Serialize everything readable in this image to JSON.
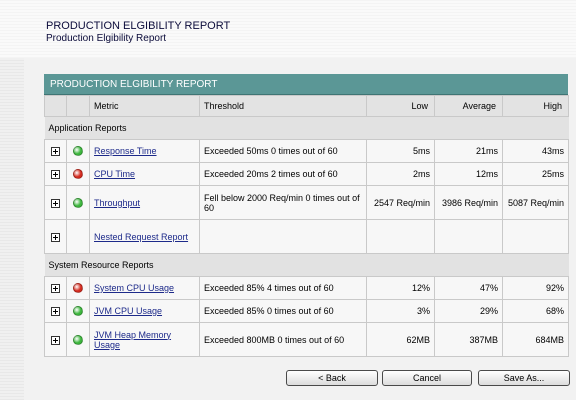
{
  "header": {
    "title": "PRODUCTION ELGIBILITY REPORT",
    "subtitle": "Production Elgibility Report"
  },
  "panel": {
    "title": "PRODUCTION ELGIBILITY REPORT",
    "columns": {
      "metric": "Metric",
      "threshold": "Threshold",
      "low": "Low",
      "average": "Average",
      "high": "High"
    }
  },
  "sections": [
    {
      "label": "Application Reports",
      "rows": [
        {
          "status": "green",
          "metric": "Response Time",
          "threshold": "Exceeded 50ms 0 times out of 60",
          "low": "5ms",
          "average": "21ms",
          "high": "43ms"
        },
        {
          "status": "red",
          "metric": "CPU Time",
          "threshold": "Exceeded 20ms 2 times out of 60",
          "low": "2ms",
          "average": "12ms",
          "high": "25ms"
        },
        {
          "status": "green",
          "metric": "Throughput",
          "threshold": "Fell below 2000 Req/min 0 times out of 60",
          "low": "2547 Req/min",
          "average": "3986 Req/min",
          "high": "5087 Req/min"
        },
        {
          "status": "none",
          "metric": "Nested Request Report",
          "threshold": "",
          "low": "",
          "average": "",
          "high": ""
        }
      ]
    },
    {
      "label": "System Resource Reports",
      "rows": [
        {
          "status": "red",
          "metric": "System CPU Usage",
          "threshold": "Exceeded 85% 4 times out of 60",
          "low": "12%",
          "average": "47%",
          "high": "92%"
        },
        {
          "status": "green",
          "metric": "JVM CPU Usage",
          "threshold": "Exceeded 85% 0 times out of 60",
          "low": "3%",
          "average": "29%",
          "high": "68%"
        },
        {
          "status": "green",
          "metric": "JVM Heap Memory Usage",
          "threshold": "Exceeded 800MB 0 times out of 60",
          "low": "62MB",
          "average": "387MB",
          "high": "684MB"
        }
      ]
    }
  ],
  "buttons": {
    "back": "< Back",
    "cancel": "Cancel",
    "save_as": "Save As..."
  },
  "colors": {
    "header_bar": "#5b9796",
    "status_green": "#3cb63c",
    "status_red": "#d42a1e",
    "link": "#1d2a8a"
  },
  "icons": {
    "expand": "plus-box-icon",
    "status": "status-dot-icon"
  }
}
